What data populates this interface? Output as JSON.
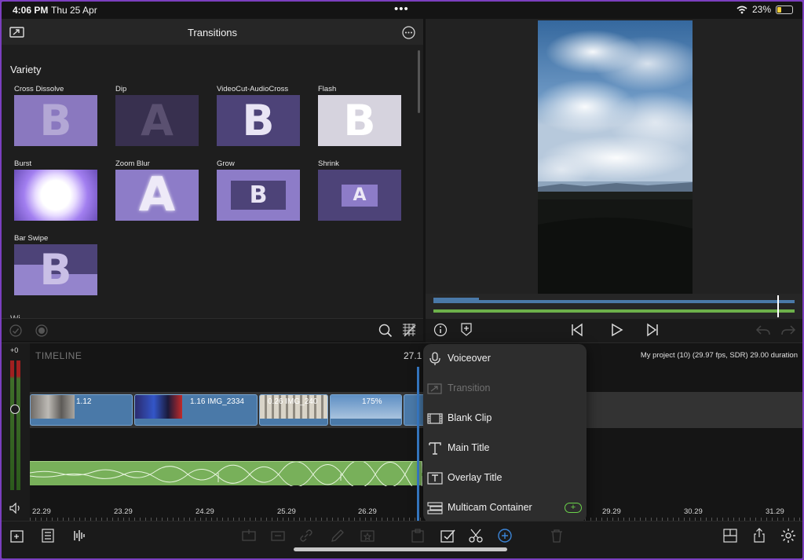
{
  "status_bar": {
    "time": "4:06 PM",
    "date": "Thu 25 Apr",
    "center_dots": "•••",
    "battery": "23%",
    "battery_level": 0.23
  },
  "left_panel": {
    "title": "Transitions",
    "section": "Variety",
    "partial_section": "Wi",
    "transitions": [
      {
        "label": "Cross Dissolve",
        "letter": "B"
      },
      {
        "label": "Dip",
        "letter": "A"
      },
      {
        "label": "VideoCut-AudioCross",
        "letter": "B"
      },
      {
        "label": "Flash",
        "letter": "B"
      },
      {
        "label": "Burst",
        "letter": ""
      },
      {
        "label": "Zoom Blur",
        "letter": "A"
      },
      {
        "label": "Grow",
        "letter": "B"
      },
      {
        "label": "Shrink",
        "letter": "A"
      },
      {
        "label": "Bar Swipe",
        "letter": "B"
      }
    ]
  },
  "timeline": {
    "label": "TIMELINE",
    "current_time": "27.1",
    "project_info": "My project (10) (29.97 fps, SDR)  29.00 duration",
    "meter_label": "+0",
    "clips": [
      {
        "info": "1.12"
      },
      {
        "info": "1.16   IMG_2334"
      },
      {
        "info": "0.26   IMG_240"
      },
      {
        "info": "175%"
      }
    ],
    "ruler": [
      "22.29",
      "23.29",
      "24.29",
      "25.29",
      "26.29",
      "29.29",
      "30.29",
      "31.29"
    ]
  },
  "menu": {
    "items": [
      {
        "label": "Voiceover",
        "icon": "mic-icon",
        "enabled": true
      },
      {
        "label": "Transition",
        "icon": "transition-icon",
        "enabled": false
      },
      {
        "label": "Blank Clip",
        "icon": "film-icon",
        "enabled": true
      },
      {
        "label": "Main Title",
        "icon": "text-icon",
        "enabled": true
      },
      {
        "label": "Overlay Title",
        "icon": "overlay-title-icon",
        "enabled": true
      },
      {
        "label": "Multicam Container",
        "icon": "multicam-icon",
        "enabled": true,
        "badge": "+"
      }
    ]
  },
  "colors": {
    "accent": "#3b84d6",
    "transition_tile": "#8a78bf",
    "audio": "#78b05a",
    "clip": "#4a79a8"
  }
}
